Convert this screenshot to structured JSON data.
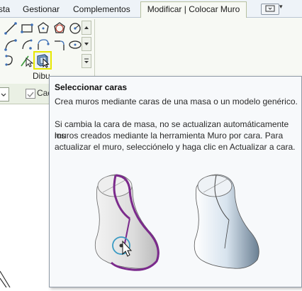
{
  "tabs": [
    {
      "label": "sta"
    },
    {
      "label": "Gestionar"
    },
    {
      "label": "Complementos"
    },
    {
      "label": "Modificar | Colocar Muro",
      "active": true
    }
  ],
  "ribbon": {
    "panel_label": "Dibu",
    "tools": [
      {
        "icon": "line-icon"
      },
      {
        "icon": "rectangle-icon"
      },
      {
        "icon": "polygon-icon"
      },
      {
        "icon": "circumscribed-polygon-icon"
      },
      {
        "icon": "circle-icon"
      },
      {
        "icon": "start-end-arc-icon"
      },
      {
        "icon": "center-arc-icon"
      },
      {
        "icon": "tangent-arc-icon"
      },
      {
        "icon": "fillet-arc-icon"
      },
      {
        "icon": "ellipse-icon"
      },
      {
        "icon": "spline-icon"
      },
      {
        "icon": "pick-lines-icon"
      },
      {
        "icon": "pick-faces-icon",
        "highlighted": true
      }
    ],
    "highlight_color": "#e8e800"
  },
  "options_bar": {
    "checkbox_label": "Cad"
  },
  "tooltip": {
    "title": "Seleccionar caras",
    "description": "Crea muros mediante caras de una masa o un modelo genérico.",
    "details_lines": [
      "Si cambia la cara de masa, no se actualizan automáticamente los",
      "muros creados mediante la herramienta Muro por cara. Para",
      "actualizar el muro, selecciónelo y haga clic en Actualizar a cara."
    ],
    "accent_color": "#7b2a8c"
  }
}
